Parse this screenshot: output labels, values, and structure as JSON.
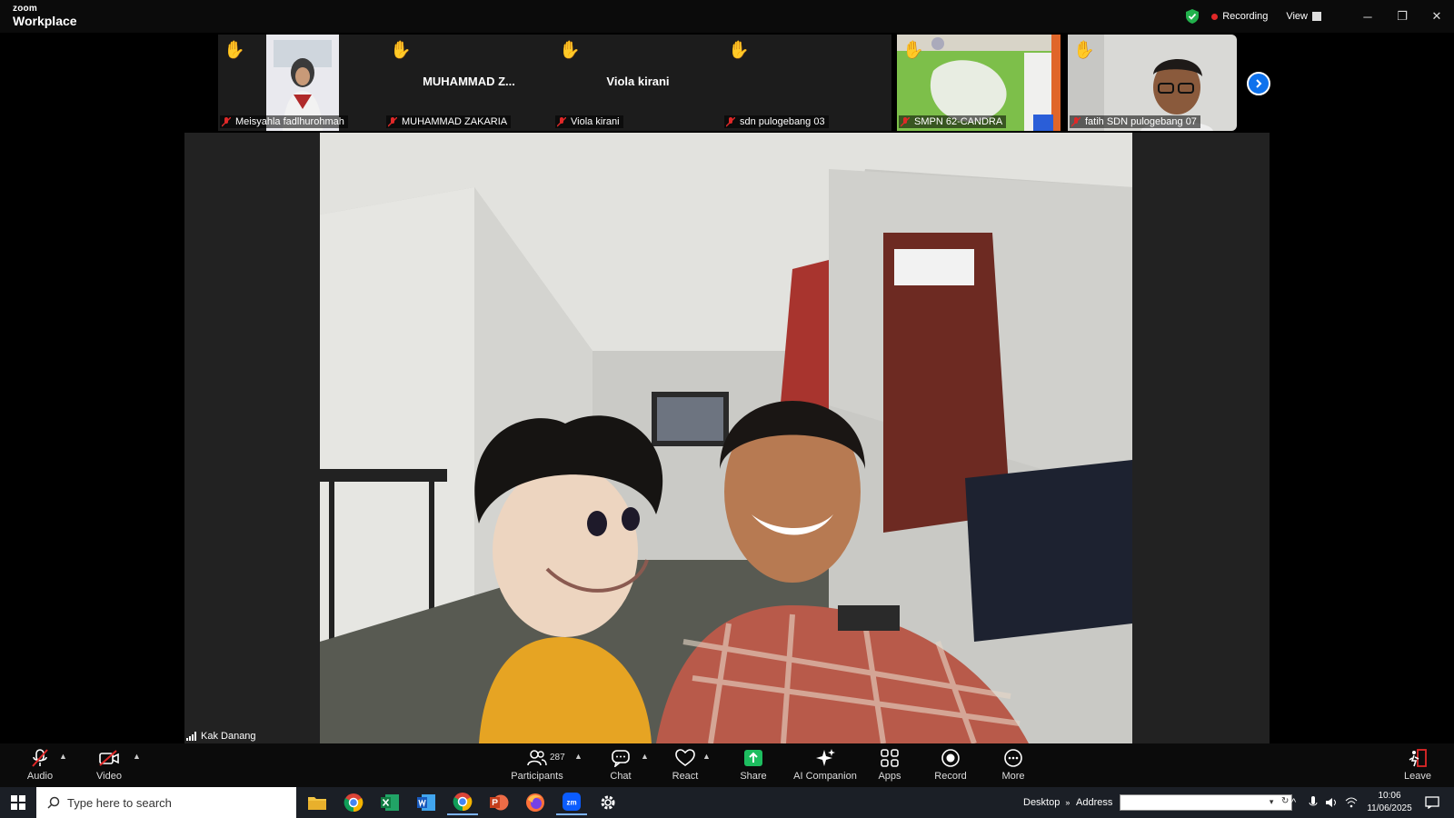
{
  "app": {
    "logo_small": "zoom",
    "logo_big": "Workplace",
    "recording_label": "Recording",
    "view_label": "View",
    "minimize": "─",
    "maximize": "❐",
    "close": "✕"
  },
  "thumbnails": [
    {
      "name": "Meisyahla fadlhurohmah",
      "display_name": "",
      "hand_raised": true,
      "kind": "camera-girl"
    },
    {
      "name": "MUHAMMAD ZAKARIA",
      "display_name": "MUHAMMAD  Z...",
      "hand_raised": true,
      "kind": "name"
    },
    {
      "name": "Viola kirani",
      "display_name": "Viola kirani",
      "hand_raised": true,
      "kind": "name"
    },
    {
      "name": "sdn pulogebang 03",
      "display_name": "",
      "hand_raised": true,
      "kind": "blank"
    },
    {
      "name": "SMPN 62-CANDRA",
      "display_name": "",
      "hand_raised": true,
      "kind": "camera-room"
    },
    {
      "name": "fatih SDN pulogebang 07",
      "display_name": "",
      "hand_raised": true,
      "kind": "camera-boy"
    }
  ],
  "speaker": {
    "name": "Kak Danang"
  },
  "toolbar": {
    "audio": "Audio",
    "video": "Video",
    "participants": "Participants",
    "participants_count": "287",
    "chat": "Chat",
    "react": "React",
    "share": "Share",
    "ai_companion": "AI Companion",
    "apps": "Apps",
    "record": "Record",
    "more": "More",
    "leave": "Leave"
  },
  "taskbar": {
    "search_placeholder": "Type here to search",
    "desktop_label": "Desktop",
    "address_label": "Address",
    "time": "10:06",
    "date": "11/06/2025"
  },
  "colors": {
    "accent_blue": "#0e72ed",
    "hand_yellow": "#f0b429",
    "muted_red": "#e02828",
    "share_green": "#1dbd5f",
    "secure_green": "#22b14c"
  }
}
